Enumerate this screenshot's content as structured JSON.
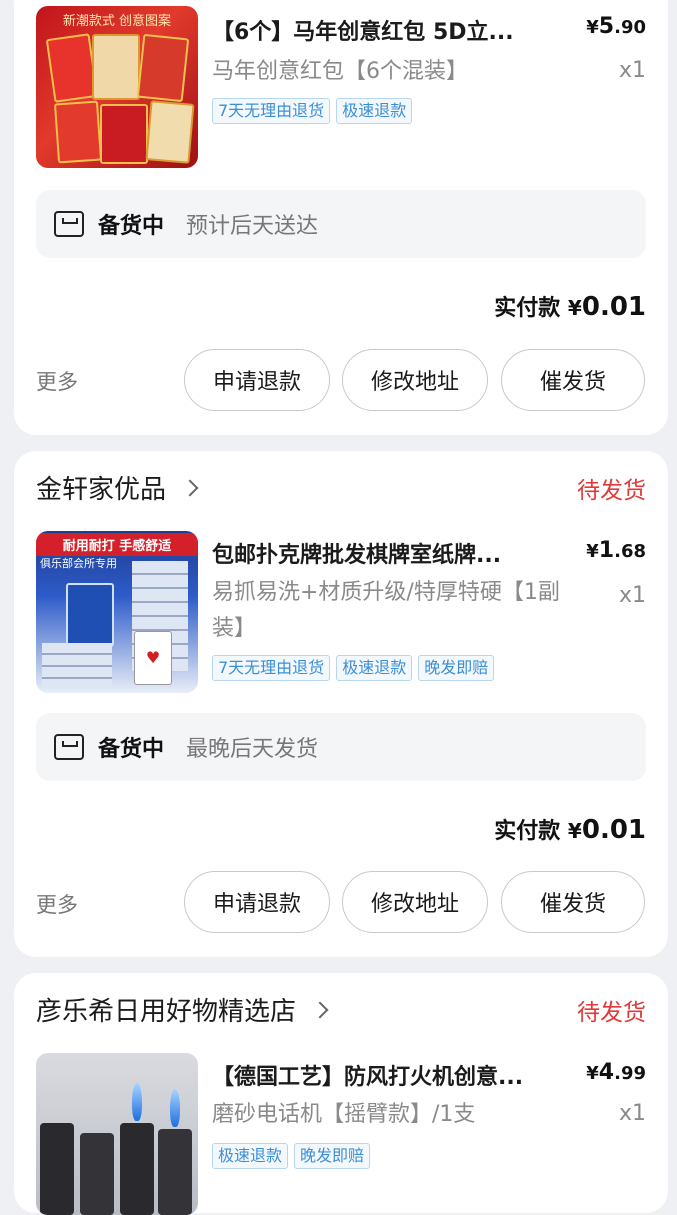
{
  "orders": [
    {
      "shop_name": "",
      "status": "",
      "title": "【6个】马年创意红包 5D立...",
      "price_symbol": "¥",
      "price_int": "5",
      "price_dec": ".90",
      "spec": "马年创意红包【6个混装】",
      "qty": "x1",
      "thumb_text": "新潮款式 创意图案",
      "tags": [
        "7天无理由退货",
        "极速退款"
      ],
      "ship_state": "备货中",
      "ship_note": "预计后天送达",
      "paid_label": "实付款",
      "paid_symbol": "¥",
      "paid_int": "0",
      "paid_dec": ".01",
      "more": "更多",
      "buttons": [
        "申请退款",
        "修改地址",
        "催发货"
      ]
    },
    {
      "shop_name": "金轩家优品",
      "status": "待发货",
      "title": "包邮扑克牌批发棋牌室纸牌...",
      "price_symbol": "¥",
      "price_int": "1",
      "price_dec": ".68",
      "spec": "易抓易洗+材质升级/特厚特硬【1副装】",
      "qty": "x1",
      "thumb_text": "耐用耐打 手感舒适",
      "thumb_sub": "俱乐部会所专用",
      "tags": [
        "7天无理由退货",
        "极速退款",
        "晚发即赔"
      ],
      "ship_state": "备货中",
      "ship_note": "最晚后天发货",
      "paid_label": "实付款",
      "paid_symbol": "¥",
      "paid_int": "0",
      "paid_dec": ".01",
      "more": "更多",
      "buttons": [
        "申请退款",
        "修改地址",
        "催发货"
      ]
    },
    {
      "shop_name": "彦乐希日用好物精选店",
      "status": "待发货",
      "title": "【德国工艺】防风打火机创意...",
      "price_symbol": "¥",
      "price_int": "4",
      "price_dec": ".99",
      "spec": "磨砂电话机【摇臂款】/1支",
      "qty": "x1",
      "tags": [
        "极速退款",
        "晚发即赔"
      ]
    }
  ]
}
